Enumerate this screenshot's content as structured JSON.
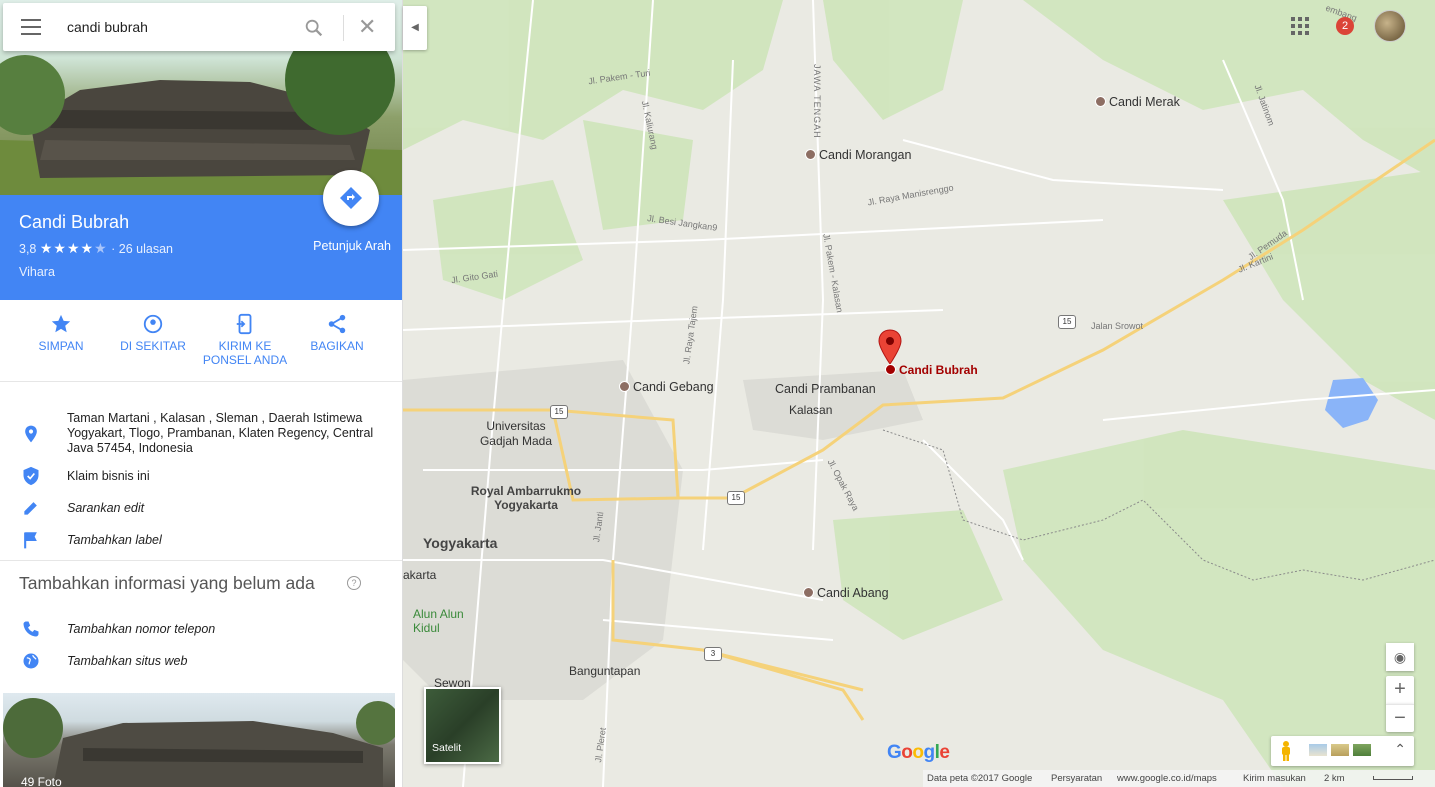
{
  "search": {
    "query": "candi bubrah"
  },
  "place": {
    "name": "Candi Bubrah",
    "rating": "3,8",
    "stars": 3.8,
    "reviews": "26 ulasan",
    "category": "Vihara",
    "directions_label": "Petunjuk Arah"
  },
  "actions": [
    {
      "label": "SIMPAN",
      "icon": "star-icon"
    },
    {
      "label": "DI SEKITAR",
      "icon": "nearby-icon"
    },
    {
      "label": "KIRIM KE PONSEL ANDA",
      "icon": "send-to-phone-icon"
    },
    {
      "label": "BAGIKAN",
      "icon": "share-icon"
    }
  ],
  "info": {
    "address": "Taman Martani , Kalasan , Sleman , Daerah Istimewa Yogyakart, Tlogo, Prambanan, Klaten Regency, Central Java 57454, Indonesia",
    "claim": "Klaim bisnis ini",
    "suggest_edit": "Sarankan edit",
    "add_label": "Tambahkan label"
  },
  "add_missing": {
    "heading": "Tambahkan informasi yang belum ada",
    "help": "?",
    "phone": "Tambahkan nomor telepon",
    "website": "Tambahkan situs web"
  },
  "photos": {
    "count": "49 Foto"
  },
  "topbar": {
    "notifications": "2"
  },
  "map": {
    "labels": {
      "candi_merak": "Candi Merak",
      "candi_morangan": "Candi Morangan",
      "candi_gebang": "Candi Gebang",
      "candi_prambanan": "Candi Prambanan",
      "kalasan": "Kalasan",
      "candi_bubrah": "Candi Bubrah",
      "ugm": "Universitas Gadjah Mada",
      "royal": "Royal Ambarrukmo Yogyakarta",
      "yogyakarta": "Yogyakarta",
      "karta": "akarta",
      "alun": "Alun Alun Kidul",
      "candi_abang": "Candi Abang",
      "sewon": "Sewon",
      "banguntapan": "Banguntapan",
      "jawa_tengah": "JAWA TENGAH",
      "jalan_srowot": "Jalan Srowot",
      "jl_pemuda": "Jl. Pemuda",
      "jl_kartini": "Jl. Kartini",
      "jl_pakem_turi": "Jl. Pakem - Turi",
      "jl_kaliurang": "Jl. Kaliurang",
      "jl_besi": "Jl. Besi Jangkan9",
      "jl_gito": "Jl. Gito Gati",
      "jl_raya_man": "Jl. Raya Manisrenggo",
      "jl_pakem_kalasan": "Jl. Pakem - Kalasan",
      "jl_tajem": "Jl. Raya Tajem",
      "jl_opak": "Jl. Opak Raya",
      "jl_janti": "Jl. Janti",
      "jl_jatinom": "Jl. Jatinom",
      "jl_pleret": "Jl. Pleret",
      "jembang": "embang"
    },
    "shields": {
      "r15a": "15",
      "r15b": "15",
      "r15c": "15",
      "r3": "3"
    },
    "satellite_label": "Satelit",
    "google": "Google",
    "footer": {
      "data": "Data peta ©2017 Google",
      "terms": "Persyaratan",
      "url": "www.google.co.id/maps",
      "feedback": "Kirim masukan",
      "scale": "2 km"
    },
    "colors": {
      "water": "#8ab4f8",
      "green": "#c9e2b3",
      "road_major": "#f8d57e",
      "pin": "#ea4335"
    }
  }
}
